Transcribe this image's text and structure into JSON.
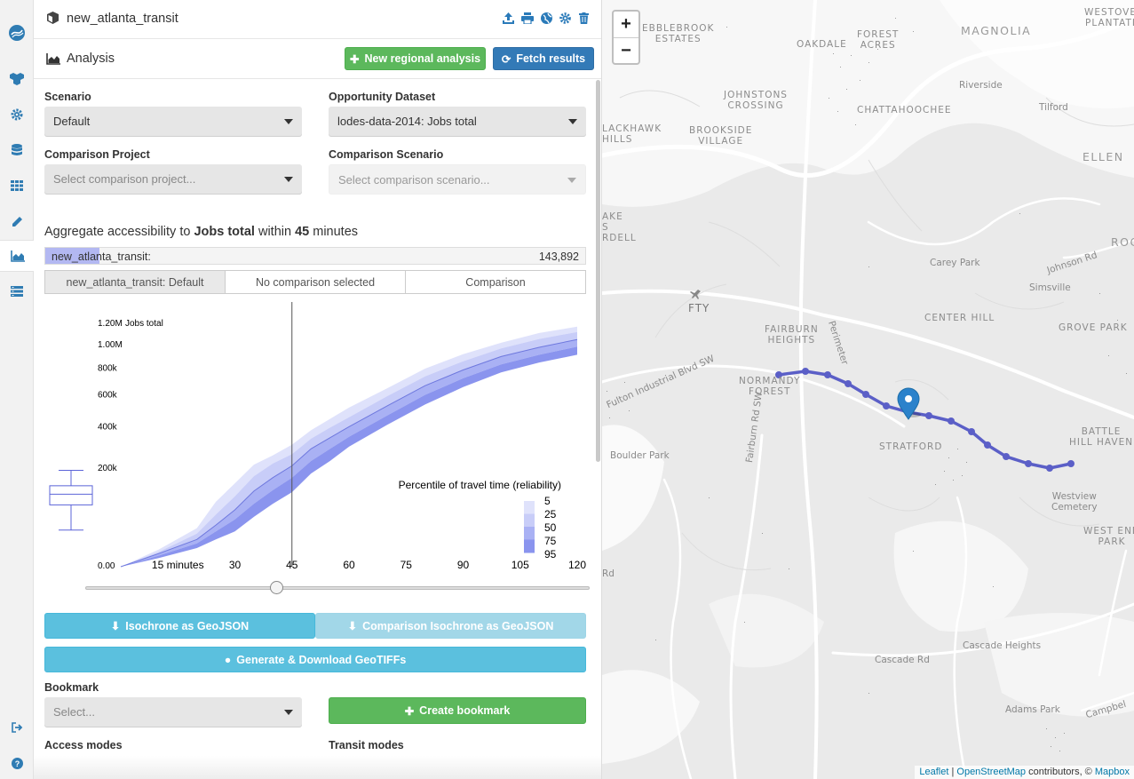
{
  "sidebar": {
    "items": [
      {
        "icon": "logo-icon"
      },
      {
        "icon": "regions-icon"
      },
      {
        "icon": "settings-gear-icon"
      },
      {
        "icon": "database-icon"
      },
      {
        "icon": "grid-icon"
      },
      {
        "icon": "pencil-icon"
      },
      {
        "icon": "area-chart-icon",
        "active": true
      },
      {
        "icon": "server-list-icon"
      },
      {
        "icon": "logout-icon"
      },
      {
        "icon": "help-icon"
      }
    ]
  },
  "project": {
    "name": "new_atlanta_transit",
    "actions": [
      "upload-icon",
      "print-icon",
      "globe-icon",
      "gear-icon",
      "trash-icon"
    ]
  },
  "analysis": {
    "title": "Analysis",
    "new_regional_label": "New regional analysis",
    "fetch_results_label": "Fetch results"
  },
  "form": {
    "scenario_label": "Scenario",
    "scenario_value": "Default",
    "opportunity_label": "Opportunity Dataset",
    "opportunity_value": "lodes-data-2014: Jobs total",
    "comparison_project_label": "Comparison Project",
    "comparison_project_placeholder": "Select comparison project...",
    "comparison_scenario_label": "Comparison Scenario",
    "comparison_scenario_placeholder": "Select comparison scenario..."
  },
  "accessibility": {
    "heading_prefix": "Aggregate accessibility to ",
    "dataset": "Jobs total",
    "heading_middle": " within ",
    "minutes": "45",
    "heading_suffix": " minutes",
    "project_label": "new_atlanta_transit:",
    "total": "143,892",
    "share_of_max": 0.1
  },
  "tabs": [
    {
      "label": "new_atlanta_transit: Default",
      "active": true
    },
    {
      "label": "No comparison selected",
      "active": false
    },
    {
      "label": "Comparison",
      "active": false
    }
  ],
  "chart_data": {
    "type": "area",
    "y_axis_title": "Jobs total",
    "x_ticks": [
      {
        "v": 0,
        "label": "0.00"
      },
      {
        "v": 15,
        "label": "15 minutes"
      },
      {
        "v": 30,
        "label": "30"
      },
      {
        "v": 45,
        "label": "45"
      },
      {
        "v": 60,
        "label": "60"
      },
      {
        "v": 75,
        "label": "75"
      },
      {
        "v": 90,
        "label": "90"
      },
      {
        "v": 105,
        "label": "105"
      },
      {
        "v": 120,
        "label": "120"
      }
    ],
    "y_ticks": [
      {
        "v": 200000,
        "label": "200k"
      },
      {
        "v": 400000,
        "label": "400k"
      },
      {
        "v": 600000,
        "label": "600k"
      },
      {
        "v": 800000,
        "label": "800k"
      },
      {
        "v": 1000000,
        "label": "1.00M"
      },
      {
        "v": 1200000,
        "label": "1.20M"
      }
    ],
    "xlim": [
      0,
      120
    ],
    "y_scale": "sqrt",
    "cutoff_minutes": 45,
    "legend_title": "Percentile of travel time (reliability)",
    "percentiles": [
      "5",
      "25",
      "50",
      "75",
      "95"
    ],
    "band_colors": [
      "#dfe2fb",
      "#c8cdf8",
      "#a9b1f4",
      "#8a94ee"
    ],
    "median_color": "#6e78de",
    "x": [
      0,
      10,
      20,
      25,
      30,
      35,
      40,
      45,
      50,
      55,
      60,
      70,
      80,
      90,
      100,
      110,
      120
    ],
    "series": [
      {
        "name": "5",
        "values": [
          0,
          6000,
          30000,
          85000,
          140000,
          210000,
          250000,
          300000,
          375000,
          440000,
          510000,
          640000,
          790000,
          910000,
          1010000,
          1100000,
          1160000
        ]
      },
      {
        "name": "25",
        "values": [
          0,
          4500,
          22000,
          55000,
          100000,
          165000,
          215000,
          255000,
          330000,
          390000,
          450000,
          585000,
          730000,
          850000,
          960000,
          1045000,
          1110000
        ]
      },
      {
        "name": "50",
        "values": [
          0,
          3500,
          15000,
          35000,
          65000,
          115000,
          160000,
          205000,
          280000,
          335000,
          395000,
          520000,
          660000,
          780000,
          890000,
          970000,
          1040000
        ]
      },
      {
        "name": "75",
        "values": [
          0,
          2500,
          11000,
          25000,
          45000,
          80000,
          118000,
          160000,
          225000,
          280000,
          340000,
          460000,
          595000,
          715000,
          825000,
          905000,
          975000
        ]
      },
      {
        "name": "95",
        "values": [
          0,
          1500,
          7000,
          15000,
          25000,
          50000,
          80000,
          112000,
          175000,
          225000,
          290000,
          405000,
          530000,
          650000,
          760000,
          840000,
          905000
        ]
      }
    ],
    "boxplot": {
      "min": 27000,
      "q1": 77000,
      "median": 106000,
      "q3": 132000,
      "max": 187000
    }
  },
  "downloads": {
    "isochrone_label": "Isochrone as GeoJSON",
    "comparison_isochrone_label": "Comparison Isochrone as GeoJSON",
    "geotiff_label": "Generate & Download GeoTIFFs"
  },
  "bookmark": {
    "label": "Bookmark",
    "placeholder": "Select...",
    "create_label": "Create bookmark"
  },
  "modes": {
    "access_label": "Access modes",
    "transit_label": "Transit modes"
  },
  "map": {
    "zoom_in": "+",
    "zoom_out": "−",
    "labels": [
      {
        "text": "EBBLEBROOK\nESTATES",
        "class": ""
      },
      {
        "text": "OAKDALE",
        "class": ""
      },
      {
        "text": "FOREST\nACRES",
        "class": ""
      },
      {
        "text": "MAGNOLIA",
        "class": "big"
      },
      {
        "text": "WESTOVE\nPLANTATI",
        "class": ""
      },
      {
        "text": "JOHNSTONS\nCROSSING",
        "class": ""
      },
      {
        "text": "CHATTAHOOCHEE",
        "class": ""
      },
      {
        "text": "Riverside",
        "class": "small"
      },
      {
        "text": "Tilford",
        "class": "small"
      },
      {
        "text": "LACKHAWK\nHILLS",
        "class": ""
      },
      {
        "text": "BROOKSIDE\nVILLAGE",
        "class": ""
      },
      {
        "text": "ELLEN",
        "class": "big"
      },
      {
        "text": "AKE\nS\nRDELL",
        "class": ""
      },
      {
        "text": "ROC",
        "class": "big"
      },
      {
        "text": "Carey Park",
        "class": "small"
      },
      {
        "text": "Johnson Rd",
        "class": "small"
      },
      {
        "text": "Simsville",
        "class": "small"
      },
      {
        "text": "FTY",
        "class": "dark"
      },
      {
        "text": "CENTER HILL",
        "class": ""
      },
      {
        "text": "FAIRBURN\nHEIGHTS",
        "class": ""
      },
      {
        "text": "Perimeter",
        "class": "small"
      },
      {
        "text": "GROVE PARK",
        "class": ""
      },
      {
        "text": "NORMANDY\nFOREST",
        "class": ""
      },
      {
        "text": "Fulton Industrial Blvd SW",
        "class": "small"
      },
      {
        "text": "STRATFORD",
        "class": ""
      },
      {
        "text": "BATTLE\nHILL HAVEN",
        "class": ""
      },
      {
        "text": "Boulder Park",
        "class": "small"
      },
      {
        "text": "Fairburn Rd SW",
        "class": "small"
      },
      {
        "text": "Westview\nCemetery",
        "class": "small"
      },
      {
        "text": "WEST END\nPARK",
        "class": ""
      },
      {
        "text": "Rd",
        "class": "small"
      },
      {
        "text": "Cascade Heights",
        "class": "small"
      },
      {
        "text": "Cascade Rd",
        "class": "small"
      },
      {
        "text": "Adams Park",
        "class": "small"
      },
      {
        "text": "Campbel",
        "class": "small"
      }
    ],
    "route_color": "#5b5fc7",
    "marker_color": "#2b82cb",
    "attribution": {
      "leaflet": "Leaflet",
      "sep": " | ",
      "osm": "OpenStreetMap",
      "contrib": " contributors, © ",
      "mapbox": "Mapbox"
    }
  }
}
